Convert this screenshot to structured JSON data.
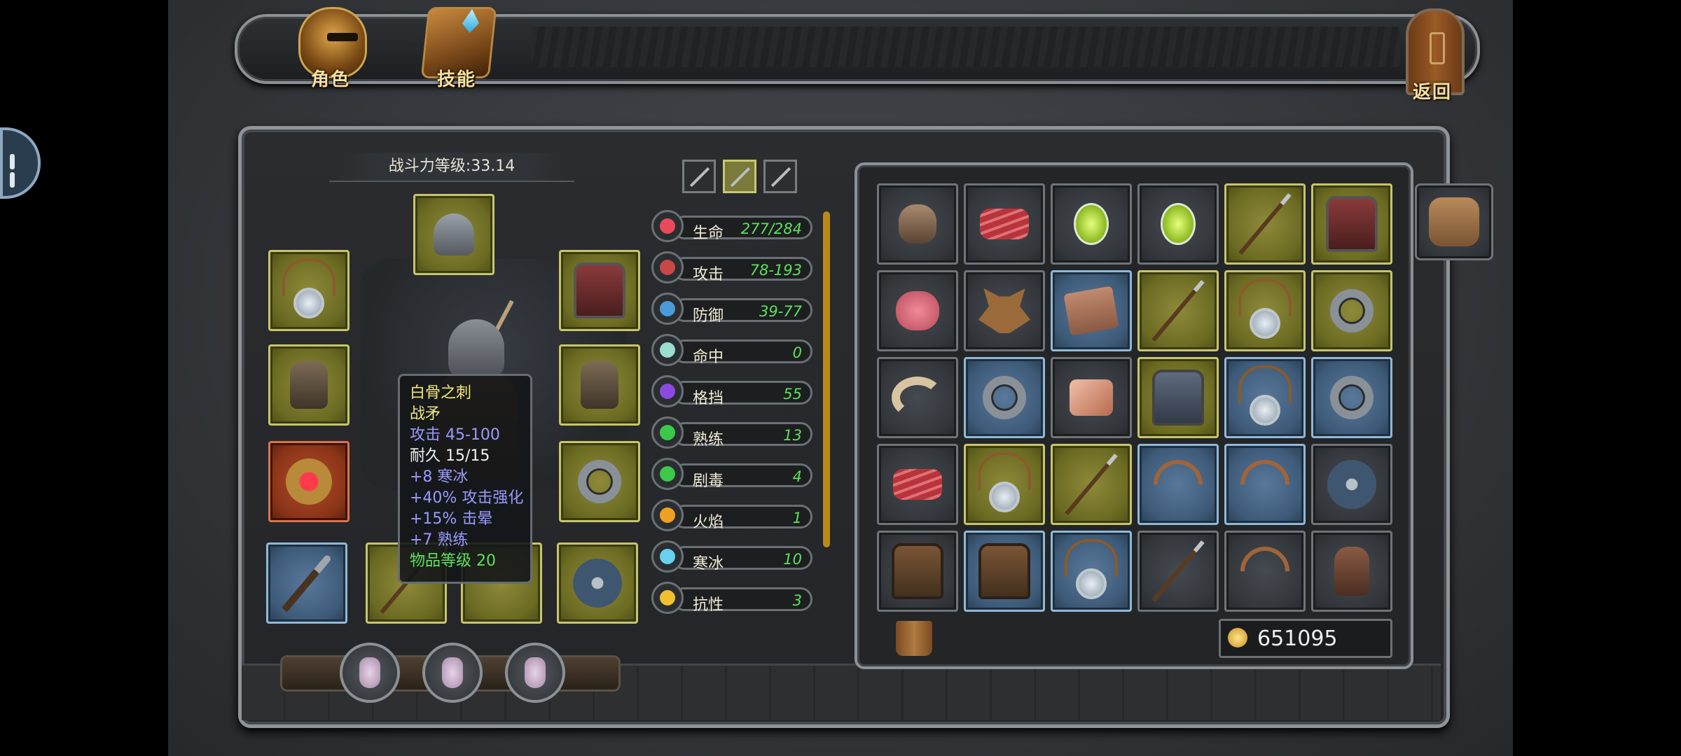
{
  "nav": {
    "role_label": "角色",
    "skill_label": "技能",
    "back_label": "返回"
  },
  "power": {
    "text": "战斗力等级:33.14"
  },
  "tooltip": {
    "name": "白骨之刺",
    "type": "战矛",
    "attack": "攻击 45-100",
    "durability": "耐久 15/15",
    "bonus1": "+8 寒冰",
    "bonus2": "+40% 攻击强化",
    "bonus3": "+15% 击晕",
    "bonus4": "+7 熟练",
    "level_label": "物品等级",
    "level_value": "20"
  },
  "stats": [
    {
      "name": "生命",
      "value": "277/284",
      "icon": "heart-icon",
      "color": "#e84a5a"
    },
    {
      "name": "攻击",
      "value": "78-193",
      "icon": "crossed-swords-icon",
      "color": "#c84848"
    },
    {
      "name": "防御",
      "value": "39-77",
      "icon": "shield-icon",
      "color": "#4a9ad8"
    },
    {
      "name": "命中",
      "value": "0",
      "icon": "crosshair-icon",
      "color": "#9adcd0"
    },
    {
      "name": "格挡",
      "value": "55",
      "icon": "running-man-icon",
      "color": "#8a4ae0"
    },
    {
      "name": "熟练",
      "value": "13",
      "icon": "clover-icon",
      "color": "#3cc84a"
    },
    {
      "name": "剧毒",
      "value": "4",
      "icon": "skull-icon",
      "color": "#3cc84a"
    },
    {
      "name": "火焰",
      "value": "1",
      "icon": "flame-icon",
      "color": "#f0a020"
    },
    {
      "name": "寒冰",
      "value": "10",
      "icon": "snowflake-icon",
      "color": "#6ad0f0"
    },
    {
      "name": "抗性",
      "value": "3",
      "icon": "star-icon",
      "color": "#f0c030"
    }
  ],
  "gold": {
    "amount": "651095"
  },
  "colors": {
    "gold_frame": "#c7c56a",
    "blue_frame": "#8fb8d8",
    "red_frame": "#d8734c",
    "stat_value": "#5ee05a",
    "tooltip_name": "#f0e87a",
    "tooltip_bonus": "#9a9aff",
    "tooltip_level": "#5ee05a"
  },
  "weapon_tabs": [
    "sword-icon",
    "spear-icon",
    "bow-icon"
  ],
  "equipment": [
    {
      "slot": "head",
      "rarity": "gold",
      "icon": "helmet-icon"
    },
    {
      "slot": "neck",
      "rarity": "gold",
      "icon": "amulet-icon"
    },
    {
      "slot": "chest",
      "rarity": "gold",
      "icon": "armor-icon"
    },
    {
      "slot": "gloves-left",
      "rarity": "gold",
      "icon": "glove-icon"
    },
    {
      "slot": "gloves-right",
      "rarity": "gold",
      "icon": "glove-icon"
    },
    {
      "slot": "ring-left",
      "rarity": "red",
      "icon": "ruby-ring-icon"
    },
    {
      "slot": "ring-right",
      "rarity": "gold",
      "icon": "ring-icon"
    },
    {
      "slot": "weapon-1",
      "rarity": "blue",
      "icon": "mace-icon"
    },
    {
      "slot": "weapon-2",
      "rarity": "gold",
      "icon": "spear-icon"
    },
    {
      "slot": "weapon-3",
      "rarity": "gold",
      "icon": "crossbow-icon"
    },
    {
      "slot": "offhand",
      "rarity": "gold",
      "icon": "round-shield-icon"
    }
  ],
  "inventory": [
    {
      "rarity": "dark",
      "icon": "pot-icon"
    },
    {
      "rarity": "dark",
      "icon": "meat-icon"
    },
    {
      "rarity": "dark",
      "icon": "potion-icon"
    },
    {
      "rarity": "dark",
      "icon": "potion-icon"
    },
    {
      "rarity": "gold",
      "icon": "spear-icon"
    },
    {
      "rarity": "gold",
      "icon": "armor-icon"
    },
    {
      "rarity": "dark",
      "icon": "heart-meat-icon"
    },
    {
      "rarity": "dark",
      "icon": "pelt-icon"
    },
    {
      "rarity": "blue",
      "icon": "scroll-icon"
    },
    {
      "rarity": "gold",
      "icon": "spear-icon"
    },
    {
      "rarity": "gold",
      "icon": "amulet-icon"
    },
    {
      "rarity": "gold",
      "icon": "ring-icon"
    },
    {
      "rarity": "dark",
      "icon": "horn-icon"
    },
    {
      "rarity": "blue",
      "icon": "ring-icon"
    },
    {
      "rarity": "dark",
      "icon": "bacon-icon"
    },
    {
      "rarity": "gold",
      "icon": "chainmail-icon"
    },
    {
      "rarity": "blue",
      "icon": "amulet-icon"
    },
    {
      "rarity": "blue",
      "icon": "ring-icon"
    },
    {
      "rarity": "dark",
      "icon": "meat-icon"
    },
    {
      "rarity": "gold",
      "icon": "amulet-icon"
    },
    {
      "rarity": "gold",
      "icon": "spear-icon"
    },
    {
      "rarity": "blue",
      "icon": "bow-icon"
    },
    {
      "rarity": "blue",
      "icon": "bow-icon"
    },
    {
      "rarity": "dark",
      "icon": "round-shield-icon"
    },
    {
      "rarity": "dark",
      "icon": "leather-armor-icon"
    },
    {
      "rarity": "blue",
      "icon": "leather-armor-icon"
    },
    {
      "rarity": "blue",
      "icon": "amulet-icon"
    },
    {
      "rarity": "dark",
      "icon": "spear-icon"
    },
    {
      "rarity": "dark",
      "icon": "bow-icon"
    },
    {
      "rarity": "dark",
      "icon": "gauntlet-icon"
    }
  ],
  "potions": [
    "flask-icon",
    "flask-icon",
    "flask-icon"
  ]
}
